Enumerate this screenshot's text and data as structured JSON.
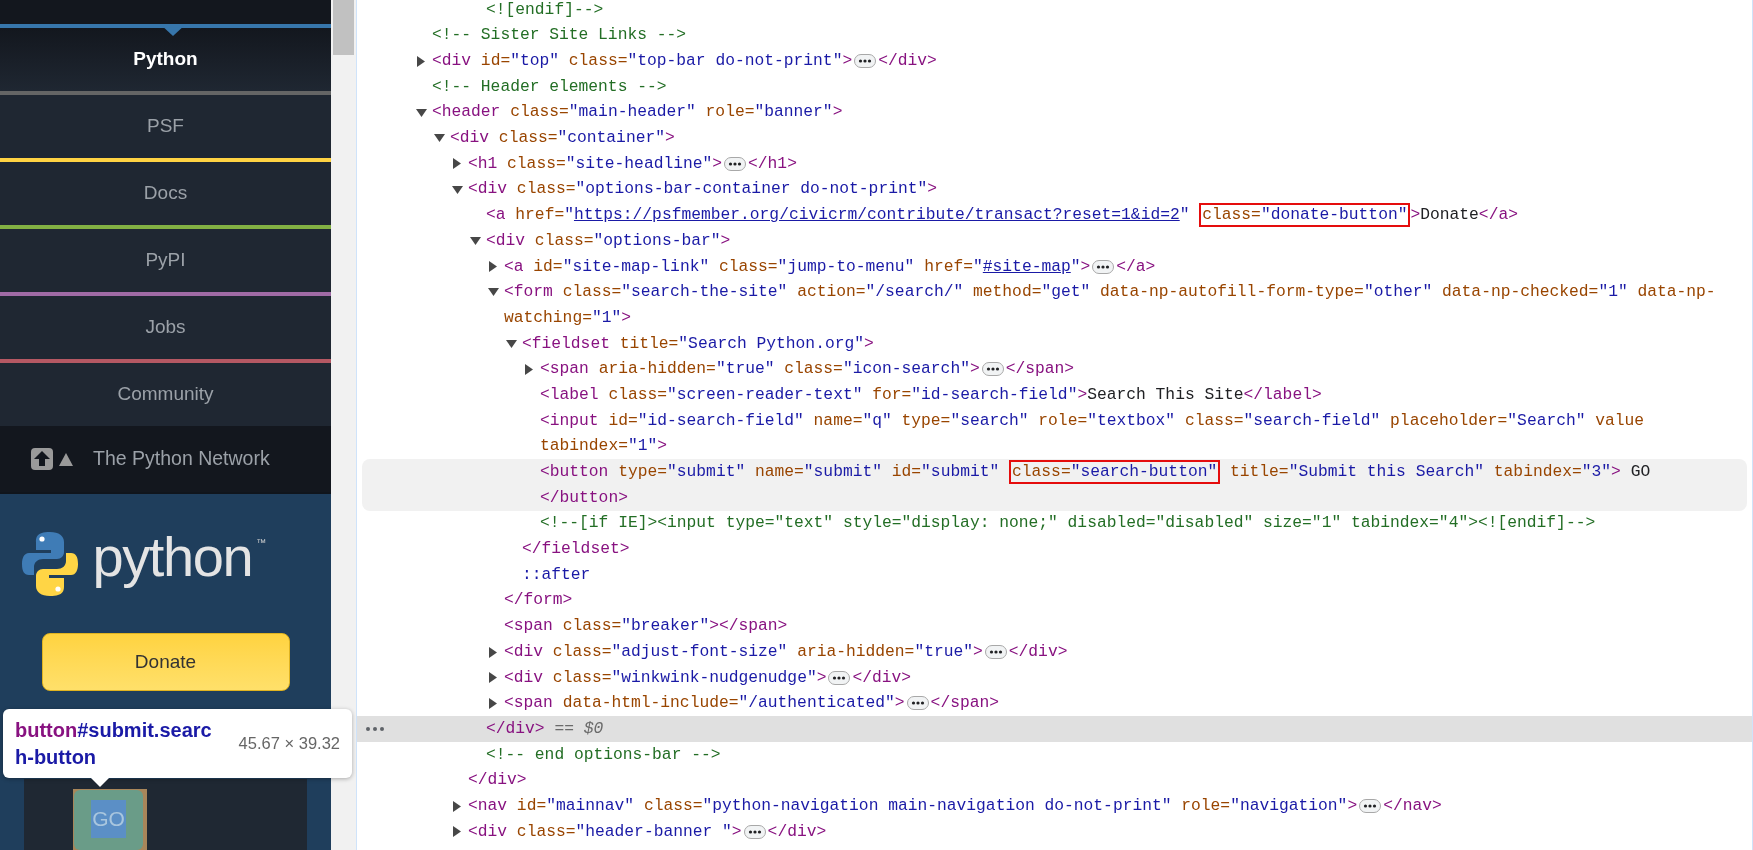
{
  "site_panel": {
    "nav": [
      {
        "label": "Python",
        "selected": true,
        "color": "#3776ab"
      },
      {
        "label": "PSF",
        "selected": false,
        "color": "#646565"
      },
      {
        "label": "Docs",
        "selected": false,
        "color": "#ffd343"
      },
      {
        "label": "PyPI",
        "selected": false,
        "color": "#82b043"
      },
      {
        "label": "Jobs",
        "selected": false,
        "color": "#a06ba6"
      },
      {
        "label": "Community",
        "selected": false,
        "color": "#b55863"
      }
    ],
    "network": {
      "label": "The Python Network"
    },
    "logo": {
      "wordmark": "python",
      "trademark": "™"
    },
    "donate_button": {
      "label": "Donate"
    },
    "tooltip": {
      "tag": "button",
      "selector": "#submit.search-button",
      "size": "45.67 × 39.32"
    },
    "search_button": {
      "label": "GO"
    }
  },
  "elements_panel": {
    "nodes": [
      {
        "kind": "tail",
        "expandable": false,
        "expanded": false,
        "selected": false,
        "lines": [
          {
            "segments": [
              {
                "kind": "comment",
                "text": "<![endif]-->"
              }
            ]
          }
        ]
      },
      {
        "kind": "line",
        "expandable": false,
        "expanded": false,
        "selected": false,
        "lines": [
          {
            "segments": [
              {
                "kind": "comment",
                "text": "<!-- Sister Site Links -->"
              }
            ]
          }
        ]
      },
      {
        "kind": "line",
        "expandable": true,
        "expanded": false,
        "selected": false,
        "lines": [
          {
            "segments": [
              {
                "kind": "tag",
                "text": "<div"
              },
              {
                "kind": "attr",
                "text": " id="
              },
              {
                "kind": "val",
                "text": "\"top\""
              },
              {
                "kind": "attr",
                "text": " class="
              },
              {
                "kind": "val",
                "text": "\"top-bar do-not-print\""
              },
              {
                "kind": "tag",
                "text": ">"
              },
              {
                "kind": "ellipsis"
              },
              {
                "kind": "tag",
                "text": "</div>"
              }
            ]
          }
        ]
      },
      {
        "kind": "line",
        "expandable": false,
        "expanded": false,
        "selected": false,
        "lines": [
          {
            "segments": [
              {
                "kind": "comment",
                "text": "<!-- Header elements -->"
              }
            ]
          }
        ]
      },
      {
        "kind": "line",
        "expandable": true,
        "expanded": true,
        "selected": false,
        "lines": [
          {
            "segments": [
              {
                "kind": "tag",
                "text": "<header"
              },
              {
                "kind": "attr",
                "text": " class="
              },
              {
                "kind": "val",
                "text": "\"main-header\""
              },
              {
                "kind": "attr",
                "text": " role="
              },
              {
                "kind": "val",
                "text": "\"banner\""
              },
              {
                "kind": "tag",
                "text": ">"
              }
            ]
          }
        ],
        "children": [
          {
            "expandable": true,
            "expanded": true,
            "selected": false,
            "lines": [
              {
                "segments": [
                  {
                    "kind": "tag",
                    "text": "<div"
                  },
                  {
                    "kind": "attr",
                    "text": " class="
                  },
                  {
                    "kind": "val",
                    "text": "\"container\""
                  },
                  {
                    "kind": "tag",
                    "text": ">"
                  }
                ]
              }
            ],
            "children": [
              {
                "expandable": true,
                "expanded": false,
                "selected": false,
                "lines": [
                  {
                    "segments": [
                      {
                        "kind": "tag",
                        "text": "<h1"
                      },
                      {
                        "kind": "attr",
                        "text": " class="
                      },
                      {
                        "kind": "val",
                        "text": "\"site-headline\""
                      },
                      {
                        "kind": "tag",
                        "text": ">"
                      },
                      {
                        "kind": "ellipsis"
                      },
                      {
                        "kind": "tag",
                        "text": "</h1>"
                      }
                    ]
                  }
                ]
              },
              {
                "expandable": true,
                "expanded": true,
                "selected": false,
                "lines": [
                  {
                    "segments": [
                      {
                        "kind": "tag",
                        "text": "<div"
                      },
                      {
                        "kind": "attr",
                        "text": " class="
                      },
                      {
                        "kind": "val",
                        "text": "\"options-bar-container do-not-print\""
                      },
                      {
                        "kind": "tag",
                        "text": ">"
                      }
                    ]
                  }
                ],
                "children": [
                  {
                    "expandable": false,
                    "expanded": false,
                    "selected": false,
                    "lines": [
                      {
                        "segments": [
                          {
                            "kind": "tag",
                            "text": "<a"
                          },
                          {
                            "kind": "attr",
                            "text": " href="
                          },
                          {
                            "kind": "val",
                            "text": "\""
                          },
                          {
                            "kind": "link",
                            "text": "https://psfmember.org/civicrm/contribute/transact?reset=1&id=2"
                          },
                          {
                            "kind": "val",
                            "text": "\" "
                          },
                          {
                            "kind": "boxed",
                            "parts": [
                              {
                                "kind": "attr",
                                "text": "class="
                              },
                              {
                                "kind": "val",
                                "text": "\"donate-button\""
                              }
                            ]
                          },
                          {
                            "kind": "tag",
                            "text": ">"
                          },
                          {
                            "kind": "text",
                            "text": "Donate"
                          },
                          {
                            "kind": "tag",
                            "text": "</a>"
                          }
                        ]
                      }
                    ]
                  },
                  {
                    "expandable": true,
                    "expanded": true,
                    "selected": false,
                    "lines": [
                      {
                        "segments": [
                          {
                            "kind": "tag",
                            "text": "<div"
                          },
                          {
                            "kind": "attr",
                            "text": " class="
                          },
                          {
                            "kind": "val",
                            "text": "\"options-bar\""
                          },
                          {
                            "kind": "tag",
                            "text": ">"
                          }
                        ]
                      }
                    ],
                    "children": [
                      {
                        "expandable": true,
                        "expanded": false,
                        "selected": false,
                        "lines": [
                          {
                            "segments": [
                              {
                                "kind": "tag",
                                "text": "<a"
                              },
                              {
                                "kind": "attr",
                                "text": " id="
                              },
                              {
                                "kind": "val",
                                "text": "\"site-map-link\""
                              },
                              {
                                "kind": "attr",
                                "text": " class="
                              },
                              {
                                "kind": "val",
                                "text": "\"jump-to-menu\""
                              },
                              {
                                "kind": "attr",
                                "text": " href="
                              },
                              {
                                "kind": "val",
                                "text": "\""
                              },
                              {
                                "kind": "link",
                                "text": "#site-map"
                              },
                              {
                                "kind": "val",
                                "text": "\""
                              },
                              {
                                "kind": "tag",
                                "text": ">"
                              },
                              {
                                "kind": "ellipsis"
                              },
                              {
                                "kind": "tag",
                                "text": "</a>"
                              }
                            ]
                          }
                        ]
                      },
                      {
                        "expandable": true,
                        "expanded": true,
                        "selected": false,
                        "lines": [
                          {
                            "segments": [
                              {
                                "kind": "tag",
                                "text": "<form"
                              },
                              {
                                "kind": "attr",
                                "text": " class="
                              },
                              {
                                "kind": "val",
                                "text": "\"search-the-site\""
                              },
                              {
                                "kind": "attr",
                                "text": " action="
                              },
                              {
                                "kind": "val",
                                "text": "\"/search/\""
                              },
                              {
                                "kind": "attr",
                                "text": " method="
                              },
                              {
                                "kind": "val",
                                "text": "\"get\""
                              },
                              {
                                "kind": "attr",
                                "text": " data-np-autofill-form-type="
                              },
                              {
                                "kind": "val",
                                "text": "\"other\""
                              },
                              {
                                "kind": "attr",
                                "text": " data-np-checked="
                              },
                              {
                                "kind": "val",
                                "text": "\"1\""
                              },
                              {
                                "kind": "attr",
                                "text": " data-np-"
                              }
                            ]
                          },
                          {
                            "segments": [
                              {
                                "kind": "attr",
                                "text": "watching="
                              },
                              {
                                "kind": "val",
                                "text": "\"1\""
                              },
                              {
                                "kind": "tag",
                                "text": ">"
                              }
                            ]
                          }
                        ],
                        "children": [
                          {
                            "expandable": true,
                            "expanded": true,
                            "selected": false,
                            "lines": [
                              {
                                "segments": [
                                  {
                                    "kind": "tag",
                                    "text": "<fieldset"
                                  },
                                  {
                                    "kind": "attr",
                                    "text": " title="
                                  },
                                  {
                                    "kind": "val",
                                    "text": "\"Search Python.org\""
                                  },
                                  {
                                    "kind": "tag",
                                    "text": ">"
                                  }
                                ]
                              }
                            ],
                            "children": [
                              {
                                "expandable": true,
                                "expanded": false,
                                "selected": false,
                                "lines": [
                                  {
                                    "segments": [
                                      {
                                        "kind": "tag",
                                        "text": "<span"
                                      },
                                      {
                                        "kind": "attr",
                                        "text": " aria-hidden="
                                      },
                                      {
                                        "kind": "val",
                                        "text": "\"true\""
                                      },
                                      {
                                        "kind": "attr",
                                        "text": " class="
                                      },
                                      {
                                        "kind": "val",
                                        "text": "\"icon-search\""
                                      },
                                      {
                                        "kind": "tag",
                                        "text": ">"
                                      },
                                      {
                                        "kind": "ellipsis"
                                      },
                                      {
                                        "kind": "tag",
                                        "text": "</span>"
                                      }
                                    ]
                                  }
                                ]
                              },
                              {
                                "expandable": false,
                                "expanded": false,
                                "selected": false,
                                "lines": [
                                  {
                                    "segments": [
                                      {
                                        "kind": "tag",
                                        "text": "<label"
                                      },
                                      {
                                        "kind": "attr",
                                        "text": " class="
                                      },
                                      {
                                        "kind": "val",
                                        "text": "\"screen-reader-text\""
                                      },
                                      {
                                        "kind": "attr",
                                        "text": " for="
                                      },
                                      {
                                        "kind": "val",
                                        "text": "\"id-search-field\""
                                      },
                                      {
                                        "kind": "tag",
                                        "text": ">"
                                      },
                                      {
                                        "kind": "text",
                                        "text": "Search This Site"
                                      },
                                      {
                                        "kind": "tag",
                                        "text": "</label>"
                                      }
                                    ]
                                  }
                                ]
                              },
                              {
                                "expandable": false,
                                "expanded": false,
                                "selected": false,
                                "lines": [
                                  {
                                    "segments": [
                                      {
                                        "kind": "tag",
                                        "text": "<input"
                                      },
                                      {
                                        "kind": "attr",
                                        "text": " id="
                                      },
                                      {
                                        "kind": "val",
                                        "text": "\"id-search-field\""
                                      },
                                      {
                                        "kind": "attr",
                                        "text": " name="
                                      },
                                      {
                                        "kind": "val",
                                        "text": "\"q\""
                                      },
                                      {
                                        "kind": "attr",
                                        "text": " type="
                                      },
                                      {
                                        "kind": "val",
                                        "text": "\"search\""
                                      },
                                      {
                                        "kind": "attr",
                                        "text": " role="
                                      },
                                      {
                                        "kind": "val",
                                        "text": "\"textbox\""
                                      },
                                      {
                                        "kind": "attr",
                                        "text": " class="
                                      },
                                      {
                                        "kind": "val",
                                        "text": "\"search-field\""
                                      },
                                      {
                                        "kind": "attr",
                                        "text": " placeholder="
                                      },
                                      {
                                        "kind": "val",
                                        "text": "\"Search\""
                                      },
                                      {
                                        "kind": "attr",
                                        "text": " value"
                                      }
                                    ]
                                  },
                                  {
                                    "segments": [
                                      {
                                        "kind": "attr",
                                        "text": "tabindex="
                                      },
                                      {
                                        "kind": "val",
                                        "text": "\"1\""
                                      },
                                      {
                                        "kind": "tag",
                                        "text": ">"
                                      }
                                    ]
                                  }
                                ]
                              },
                              {
                                "expandable": false,
                                "expanded": false,
                                "selected": false,
                                "hovered": true,
                                "lines": [
                                  {
                                    "segments": [
                                      {
                                        "kind": "tag",
                                        "text": "<button"
                                      },
                                      {
                                        "kind": "attr",
                                        "text": " type="
                                      },
                                      {
                                        "kind": "val",
                                        "text": "\"submit\""
                                      },
                                      {
                                        "kind": "attr",
                                        "text": " name="
                                      },
                                      {
                                        "kind": "val",
                                        "text": "\"submit\""
                                      },
                                      {
                                        "kind": "attr",
                                        "text": " id="
                                      },
                                      {
                                        "kind": "val",
                                        "text": "\"submit\" "
                                      },
                                      {
                                        "kind": "boxed",
                                        "parts": [
                                          {
                                            "kind": "attr",
                                            "text": "class="
                                          },
                                          {
                                            "kind": "val",
                                            "text": "\"search-button\""
                                          }
                                        ]
                                      },
                                      {
                                        "kind": "attr",
                                        "text": " title="
                                      },
                                      {
                                        "kind": "val",
                                        "text": "\"Submit this Search\""
                                      },
                                      {
                                        "kind": "attr",
                                        "text": " tabindex="
                                      },
                                      {
                                        "kind": "val",
                                        "text": "\"3\""
                                      },
                                      {
                                        "kind": "tag",
                                        "text": ">"
                                      },
                                      {
                                        "kind": "text",
                                        "text": " GO"
                                      }
                                    ]
                                  },
                                  {
                                    "segments": [
                                      {
                                        "kind": "tag",
                                        "text": "</button>"
                                      }
                                    ]
                                  }
                                ]
                              },
                              {
                                "expandable": false,
                                "expanded": false,
                                "selected": false,
                                "lines": [
                                  {
                                    "segments": [
                                      {
                                        "kind": "comment",
                                        "text": "<!--[if IE]><input type=\"text\" style=\"display: none;\" disabled=\"disabled\" size=\"1\" tabindex=\"4\"><![endif]-->"
                                      }
                                    ]
                                  }
                                ]
                              }
                            ],
                            "end": {
                              "selected": false,
                              "lines": [
                                {
                                  "segments": [
                                    {
                                      "kind": "tag",
                                      "text": "</fieldset>"
                                    }
                                  ]
                                }
                              ]
                            }
                          },
                          {
                            "expandable": false,
                            "expanded": false,
                            "selected": false,
                            "lines": [
                              {
                                "segments": [
                                  {
                                    "kind": "pseudo",
                                    "text": "::after"
                                  }
                                ]
                              }
                            ]
                          }
                        ],
                        "end": {
                          "selected": false,
                          "lines": [
                            {
                              "segments": [
                                {
                                  "kind": "tag",
                                  "text": "</form>"
                                }
                              ]
                            }
                          ]
                        }
                      },
                      {
                        "expandable": false,
                        "expanded": false,
                        "selected": false,
                        "lines": [
                          {
                            "segments": [
                              {
                                "kind": "tag",
                                "text": "<span"
                              },
                              {
                                "kind": "attr",
                                "text": " class="
                              },
                              {
                                "kind": "val",
                                "text": "\"breaker\""
                              },
                              {
                                "kind": "tag",
                                "text": "></span>"
                              }
                            ]
                          }
                        ]
                      },
                      {
                        "expandable": true,
                        "expanded": false,
                        "selected": false,
                        "lines": [
                          {
                            "segments": [
                              {
                                "kind": "tag",
                                "text": "<div"
                              },
                              {
                                "kind": "attr",
                                "text": " class="
                              },
                              {
                                "kind": "val",
                                "text": "\"adjust-font-size\""
                              },
                              {
                                "kind": "attr",
                                "text": " aria-hidden="
                              },
                              {
                                "kind": "val",
                                "text": "\"true\""
                              },
                              {
                                "kind": "tag",
                                "text": ">"
                              },
                              {
                                "kind": "ellipsis"
                              },
                              {
                                "kind": "tag",
                                "text": "</div>"
                              }
                            ]
                          }
                        ]
                      },
                      {
                        "expandable": true,
                        "expanded": false,
                        "selected": false,
                        "lines": [
                          {
                            "segments": [
                              {
                                "kind": "tag",
                                "text": "<div"
                              },
                              {
                                "kind": "attr",
                                "text": " class="
                              },
                              {
                                "kind": "val",
                                "text": "\"winkwink-nudgenudge\""
                              },
                              {
                                "kind": "tag",
                                "text": ">"
                              },
                              {
                                "kind": "ellipsis"
                              },
                              {
                                "kind": "tag",
                                "text": "</div>"
                              }
                            ]
                          }
                        ]
                      },
                      {
                        "expandable": true,
                        "expanded": false,
                        "selected": false,
                        "lines": [
                          {
                            "segments": [
                              {
                                "kind": "tag",
                                "text": "<span"
                              },
                              {
                                "kind": "attr",
                                "text": " data-html-include="
                              },
                              {
                                "kind": "val",
                                "text": "\"/authenticated\""
                              },
                              {
                                "kind": "tag",
                                "text": ">"
                              },
                              {
                                "kind": "ellipsis"
                              },
                              {
                                "kind": "tag",
                                "text": "</span>"
                              }
                            ]
                          }
                        ]
                      }
                    ],
                    "end": {
                      "selected": true,
                      "lines": [
                        {
                          "segments": [
                            {
                              "kind": "tag",
                              "text": "</div>"
                            },
                            {
                              "kind": "hint",
                              "text": " == $0"
                            }
                          ]
                        }
                      ]
                    }
                  },
                  {
                    "expandable": false,
                    "expanded": false,
                    "selected": false,
                    "lines": [
                      {
                        "segments": [
                          {
                            "kind": "comment",
                            "text": "<!-- end options-bar -->"
                          }
                        ]
                      }
                    ]
                  }
                ],
                "end": {
                  "selected": false,
                  "lines": [
                    {
                      "segments": [
                        {
                          "kind": "tag",
                          "text": "</div>"
                        }
                      ]
                    }
                  ]
                }
              },
              {
                "expandable": true,
                "expanded": false,
                "selected": false,
                "lines": [
                  {
                    "segments": [
                      {
                        "kind": "tag",
                        "text": "<nav"
                      },
                      {
                        "kind": "attr",
                        "text": " id="
                      },
                      {
                        "kind": "val",
                        "text": "\"mainnav\""
                      },
                      {
                        "kind": "attr",
                        "text": " class="
                      },
                      {
                        "kind": "val",
                        "text": "\"python-navigation main-navigation do-not-print\""
                      },
                      {
                        "kind": "attr",
                        "text": " role="
                      },
                      {
                        "kind": "val",
                        "text": "\"navigation\""
                      },
                      {
                        "kind": "tag",
                        "text": ">"
                      },
                      {
                        "kind": "ellipsis"
                      },
                      {
                        "kind": "tag",
                        "text": "</nav>"
                      }
                    ]
                  }
                ]
              },
              {
                "expandable": true,
                "expanded": false,
                "selected": false,
                "lines": [
                  {
                    "segments": [
                      {
                        "kind": "tag",
                        "text": "<div"
                      },
                      {
                        "kind": "attr",
                        "text": " class="
                      },
                      {
                        "kind": "val",
                        "text": "\"header-banner \""
                      },
                      {
                        "kind": "tag",
                        "text": ">"
                      },
                      {
                        "kind": "ellipsis"
                      },
                      {
                        "kind": "tag",
                        "text": "</div>"
                      }
                    ]
                  }
                ]
              }
            ]
          }
        ]
      }
    ]
  }
}
